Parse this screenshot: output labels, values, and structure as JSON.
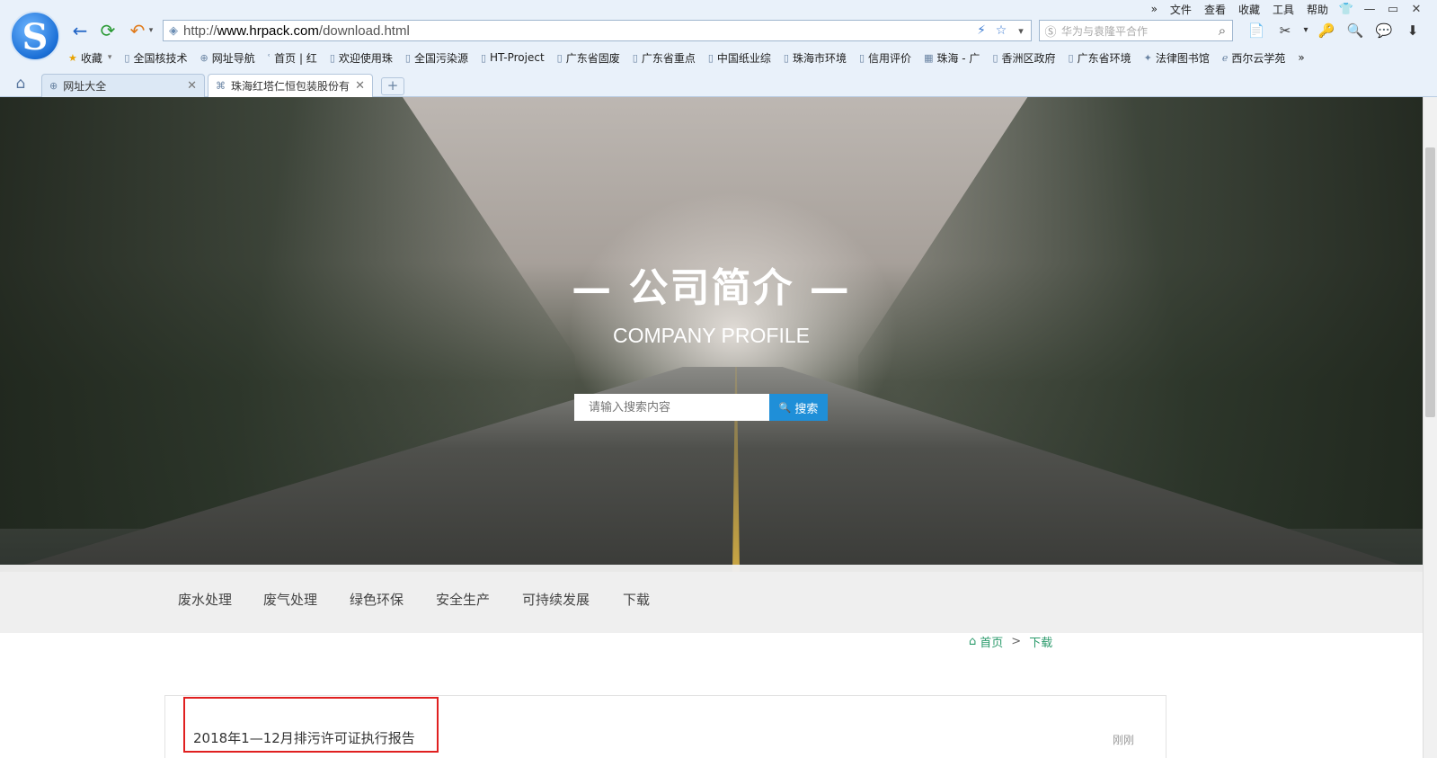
{
  "browser": {
    "menu": [
      "文件",
      "查看",
      "收藏",
      "工具",
      "帮助"
    ],
    "menu_more": "»",
    "window_controls": {
      "skin": "👕",
      "minimize": "—",
      "restore": "▭",
      "close": "✕"
    },
    "logo_letter": "S",
    "nav": {
      "back": "←",
      "refresh": "⟳",
      "undo": "↶",
      "undo_dropdown": "▾"
    },
    "address": {
      "scheme": "http://",
      "host": "www.hrpack.com",
      "path": "/download.html"
    },
    "address_icons": [
      "⚡",
      "☆",
      "▾"
    ],
    "search": {
      "engine_icon": "Ⓢ",
      "placeholder": "华为与袁隆平合作",
      "button": "⌕"
    },
    "tools": [
      "📄",
      "✂",
      "▾",
      "🔑",
      "🔍",
      "💬",
      "⬇"
    ],
    "bookmarks": [
      {
        "label": "收藏",
        "icon": "★",
        "dropdown": "▾"
      },
      {
        "label": "全国核技术",
        "icon": "▯"
      },
      {
        "label": "网址导航",
        "icon": "⊕"
      },
      {
        "label": "首页 | 红",
        "icon": "ʿ"
      },
      {
        "label": "欢迎使用珠",
        "icon": "▯"
      },
      {
        "label": "全国污染源",
        "icon": "▯"
      },
      {
        "label": "HT-Project",
        "icon": "▯"
      },
      {
        "label": "广东省固废",
        "icon": "▯"
      },
      {
        "label": "广东省重点",
        "icon": "▯"
      },
      {
        "label": "中国纸业综",
        "icon": "▯"
      },
      {
        "label": "珠海市环境",
        "icon": "▯"
      },
      {
        "label": "信用评价",
        "icon": "▯"
      },
      {
        "label": "珠海 - 广",
        "icon": "▦"
      },
      {
        "label": "香洲区政府",
        "icon": "▯"
      },
      {
        "label": "广东省环境",
        "icon": "▯"
      },
      {
        "label": "法律图书馆",
        "icon": "✦"
      },
      {
        "label": "西尔云学苑",
        "icon": "ℯ"
      }
    ],
    "bookmarks_more": "»",
    "tabs": [
      {
        "label": "网址大全",
        "icon": "⊕",
        "close": "✕"
      },
      {
        "label": "珠海红塔仁恒包装股份有",
        "icon": "⌘",
        "close": "✕"
      }
    ],
    "home_icon": "⌂",
    "new_tab": "+"
  },
  "hero": {
    "title": "— 公司简介 —",
    "subtitle": "COMPANY PROFILE",
    "search_placeholder": "请输入搜索内容",
    "search_button": "搜索",
    "search_icon": "🔍"
  },
  "subnav": [
    "废水处理",
    "废气处理",
    "绿色环保",
    "安全生产",
    "可持续发展",
    "下载"
  ],
  "breadcrumb": {
    "home_icon": "⌂",
    "home": "首页",
    "separator": ">",
    "current": "下载"
  },
  "downloads": [
    {
      "title": "2018年1—12月排污许可证执行报告",
      "time": "刚刚"
    }
  ]
}
